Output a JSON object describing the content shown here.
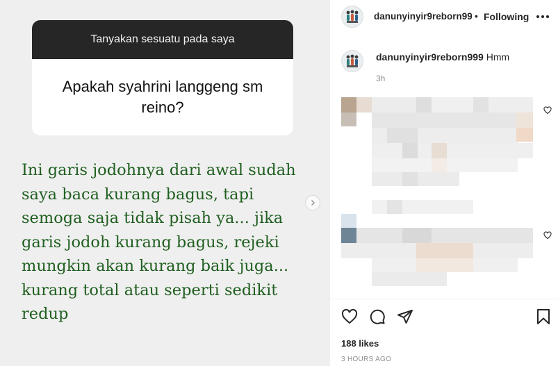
{
  "story_question": {
    "header": "Tanyakan sesuatu pada saya",
    "question": "Apakah syahrini langgeng sm reino?"
  },
  "answer_lines": [
    "Ini garis jodohnya dari awal sudah",
    "saya baca kurang bagus, tapi",
    "semoga saja tidak pisah ya... jika",
    "garis jodoh kurang bagus, rejeki",
    "mungkin akan kurang baik juga...",
    "kurang total atau seperti sedikit",
    "redup"
  ],
  "post_header": {
    "username": "danunyinyir9reborn999",
    "separator": "•",
    "follow_label": "Following"
  },
  "caption": {
    "username": "danunyinyir9reborn999",
    "text": "Hmm",
    "time": "3h"
  },
  "engagement": {
    "likes": "188 likes",
    "time": "3 HOURS AGO"
  },
  "colors": {
    "answer_text": "#1f5f1f",
    "question_header_bg": "#262626",
    "image_bg": "#efefef"
  },
  "icons": [
    "more-options-icon",
    "heart-icon",
    "comment-icon",
    "share-icon",
    "bookmark-icon",
    "next-arrow-icon"
  ]
}
